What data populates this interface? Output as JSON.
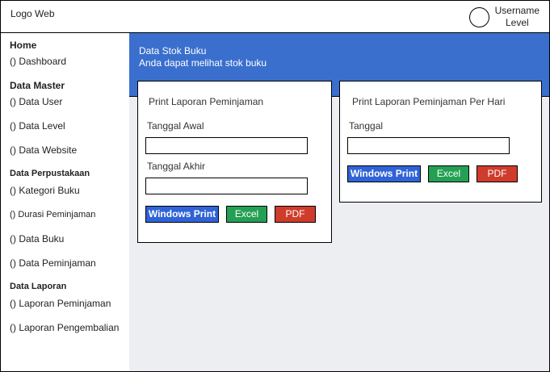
{
  "header": {
    "logo": "Logo Web",
    "username": "Username",
    "level": "Level",
    "avatar_icon": "user-avatar-circle"
  },
  "sidebar": {
    "home_heading": "Home",
    "dashboard": "() Dashboard",
    "data_master_heading": "Data Master",
    "data_user": "() Data User",
    "data_level": "() Data Level",
    "data_website": "() Data Website",
    "data_perpustakaan_heading": "Data Perpustakaan",
    "kategori_buku": "() Kategori Buku",
    "durasi_peminjaman": "() Durasi Peminjaman",
    "data_buku": "() Data Buku",
    "data_peminjaman": "() Data Peminjaman",
    "data_laporan_heading": "Data Laporan",
    "laporan_peminjaman": "() Laporan Peminjaman",
    "laporan_pengembalian": "() Laporan Pengembalian"
  },
  "banner": {
    "title": "Data Stok Buku",
    "subtitle": "Anda dapat melihat stok buku"
  },
  "card1": {
    "title": "Print Laporan Peminjaman",
    "start_label": "Tanggal Awal",
    "start_value": "",
    "end_label": "Tanggal Akhir",
    "end_value": "",
    "print_label": "Windows Print",
    "excel_label": "Excel",
    "pdf_label": "PDF"
  },
  "card2": {
    "title": "Print Laporan Peminjaman Per Hari",
    "date_label": "Tanggal",
    "date_value": "",
    "print_label": "Windows Print",
    "excel_label": "Excel",
    "pdf_label": "PDF"
  },
  "colors": {
    "banner": "#3a6fce",
    "print_button": "#2f63d6",
    "excel_button": "#23a053",
    "pdf_button": "#cf3c2c",
    "content_bg": "#eceef2"
  }
}
